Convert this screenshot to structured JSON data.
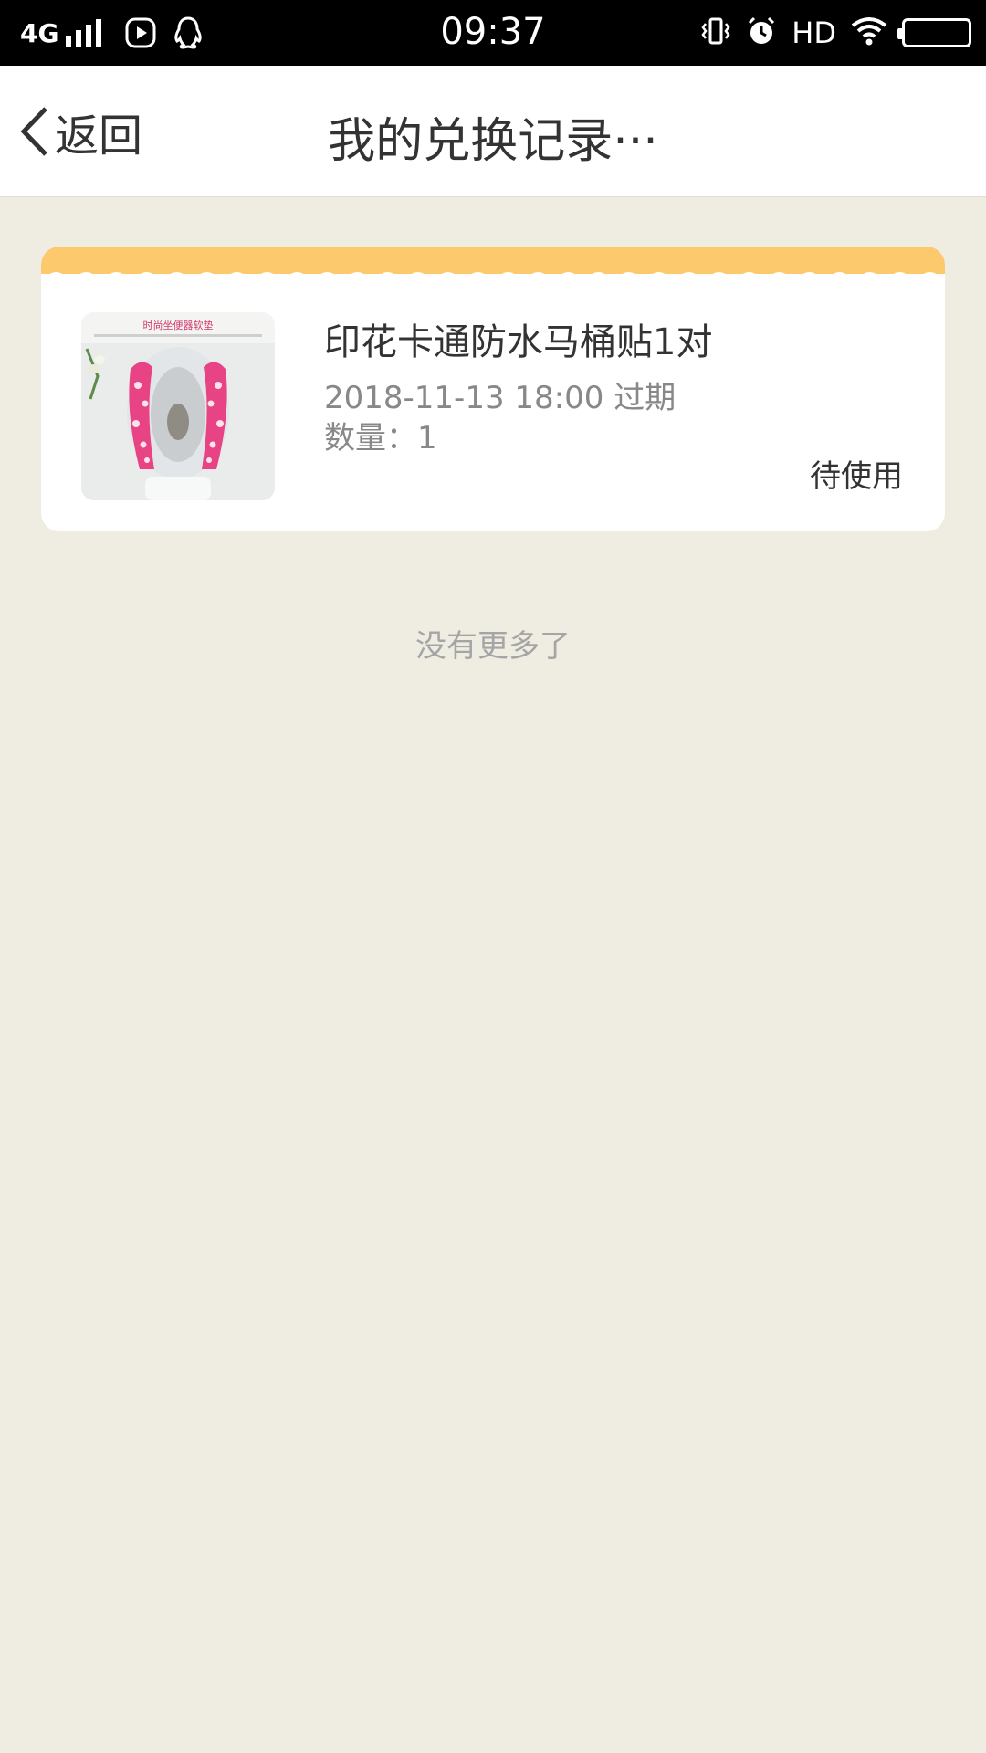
{
  "status_bar": {
    "network": "4G",
    "time": "09:37",
    "hd": "HD",
    "icons": [
      "signal-icon",
      "video-play-icon",
      "qq-icon",
      "vibrate-icon",
      "alarm-icon",
      "wifi-icon",
      "battery-icon"
    ]
  },
  "nav": {
    "back_label": "返回",
    "title": "我的兑换记录···"
  },
  "records": [
    {
      "name": "印花卡通防水马桶贴1对",
      "expiry": "2018-11-13 18:00 过期",
      "qty_label": "数量：",
      "qty_value": "1",
      "status": "待使用",
      "image_caption": "时尚坐便器软垫"
    }
  ],
  "footer": {
    "no_more": "没有更多了"
  },
  "colors": {
    "page_bg": "#efede2",
    "card_strip": "#fcc96d",
    "card_bg": "#ffffff",
    "status_bar_bg": "#000000"
  }
}
